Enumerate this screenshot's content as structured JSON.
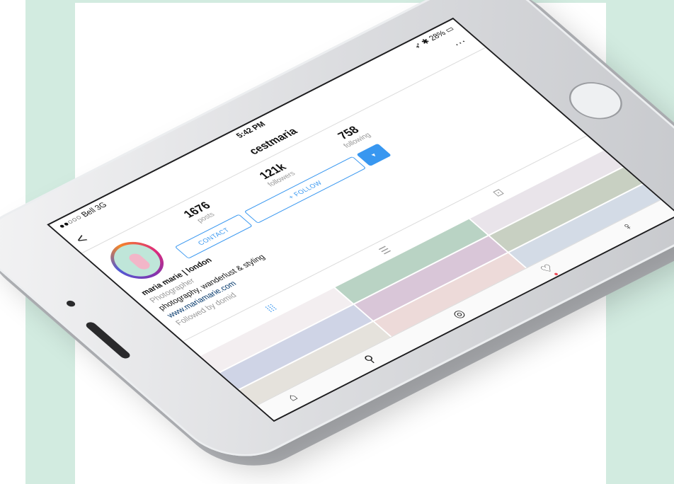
{
  "status_bar": {
    "carrier": "●●○○○ Bell 3G",
    "time": "5:42 PM",
    "battery": "➶ ✱ 28% ▭"
  },
  "nav": {
    "back_icon": "chevron-left-icon",
    "back_glyph": "<",
    "username": "cestmaria",
    "more_glyph": "···"
  },
  "profile": {
    "stats": [
      {
        "value": "1676",
        "label": "posts"
      },
      {
        "value": "121k",
        "label": "followers"
      },
      {
        "value": "758",
        "label": "following"
      }
    ],
    "contact_label": "CONTACT",
    "follow_label": "+ FOLLOW",
    "dropdown_glyph": "▾",
    "name": "maria marie | london",
    "category": "Photographer",
    "description": "photography, wanderlust & styling",
    "link": "www.mariamarie.com",
    "followed_by": "Followed by domid"
  },
  "tabs": {
    "grid_glyph": "⁞⁞⁞",
    "list_glyph": "☰",
    "tag_glyph": "⊡"
  },
  "grid_colors": [
    "#f3eef0",
    "#b9d3c4",
    "#e9e4ea",
    "#cfd4e6",
    "#d9c6d8",
    "#c8d0c2",
    "#e5e2dc",
    "#eddad9",
    "#d3dbe6"
  ],
  "bottom_nav": {
    "home_glyph": "⌂",
    "search_glyph": "⚲",
    "camera_glyph": "◎",
    "heart_glyph": "♡",
    "profile_glyph": "♀"
  },
  "colors": {
    "accent": "#3897f0",
    "mint": "#d2ebe0"
  }
}
